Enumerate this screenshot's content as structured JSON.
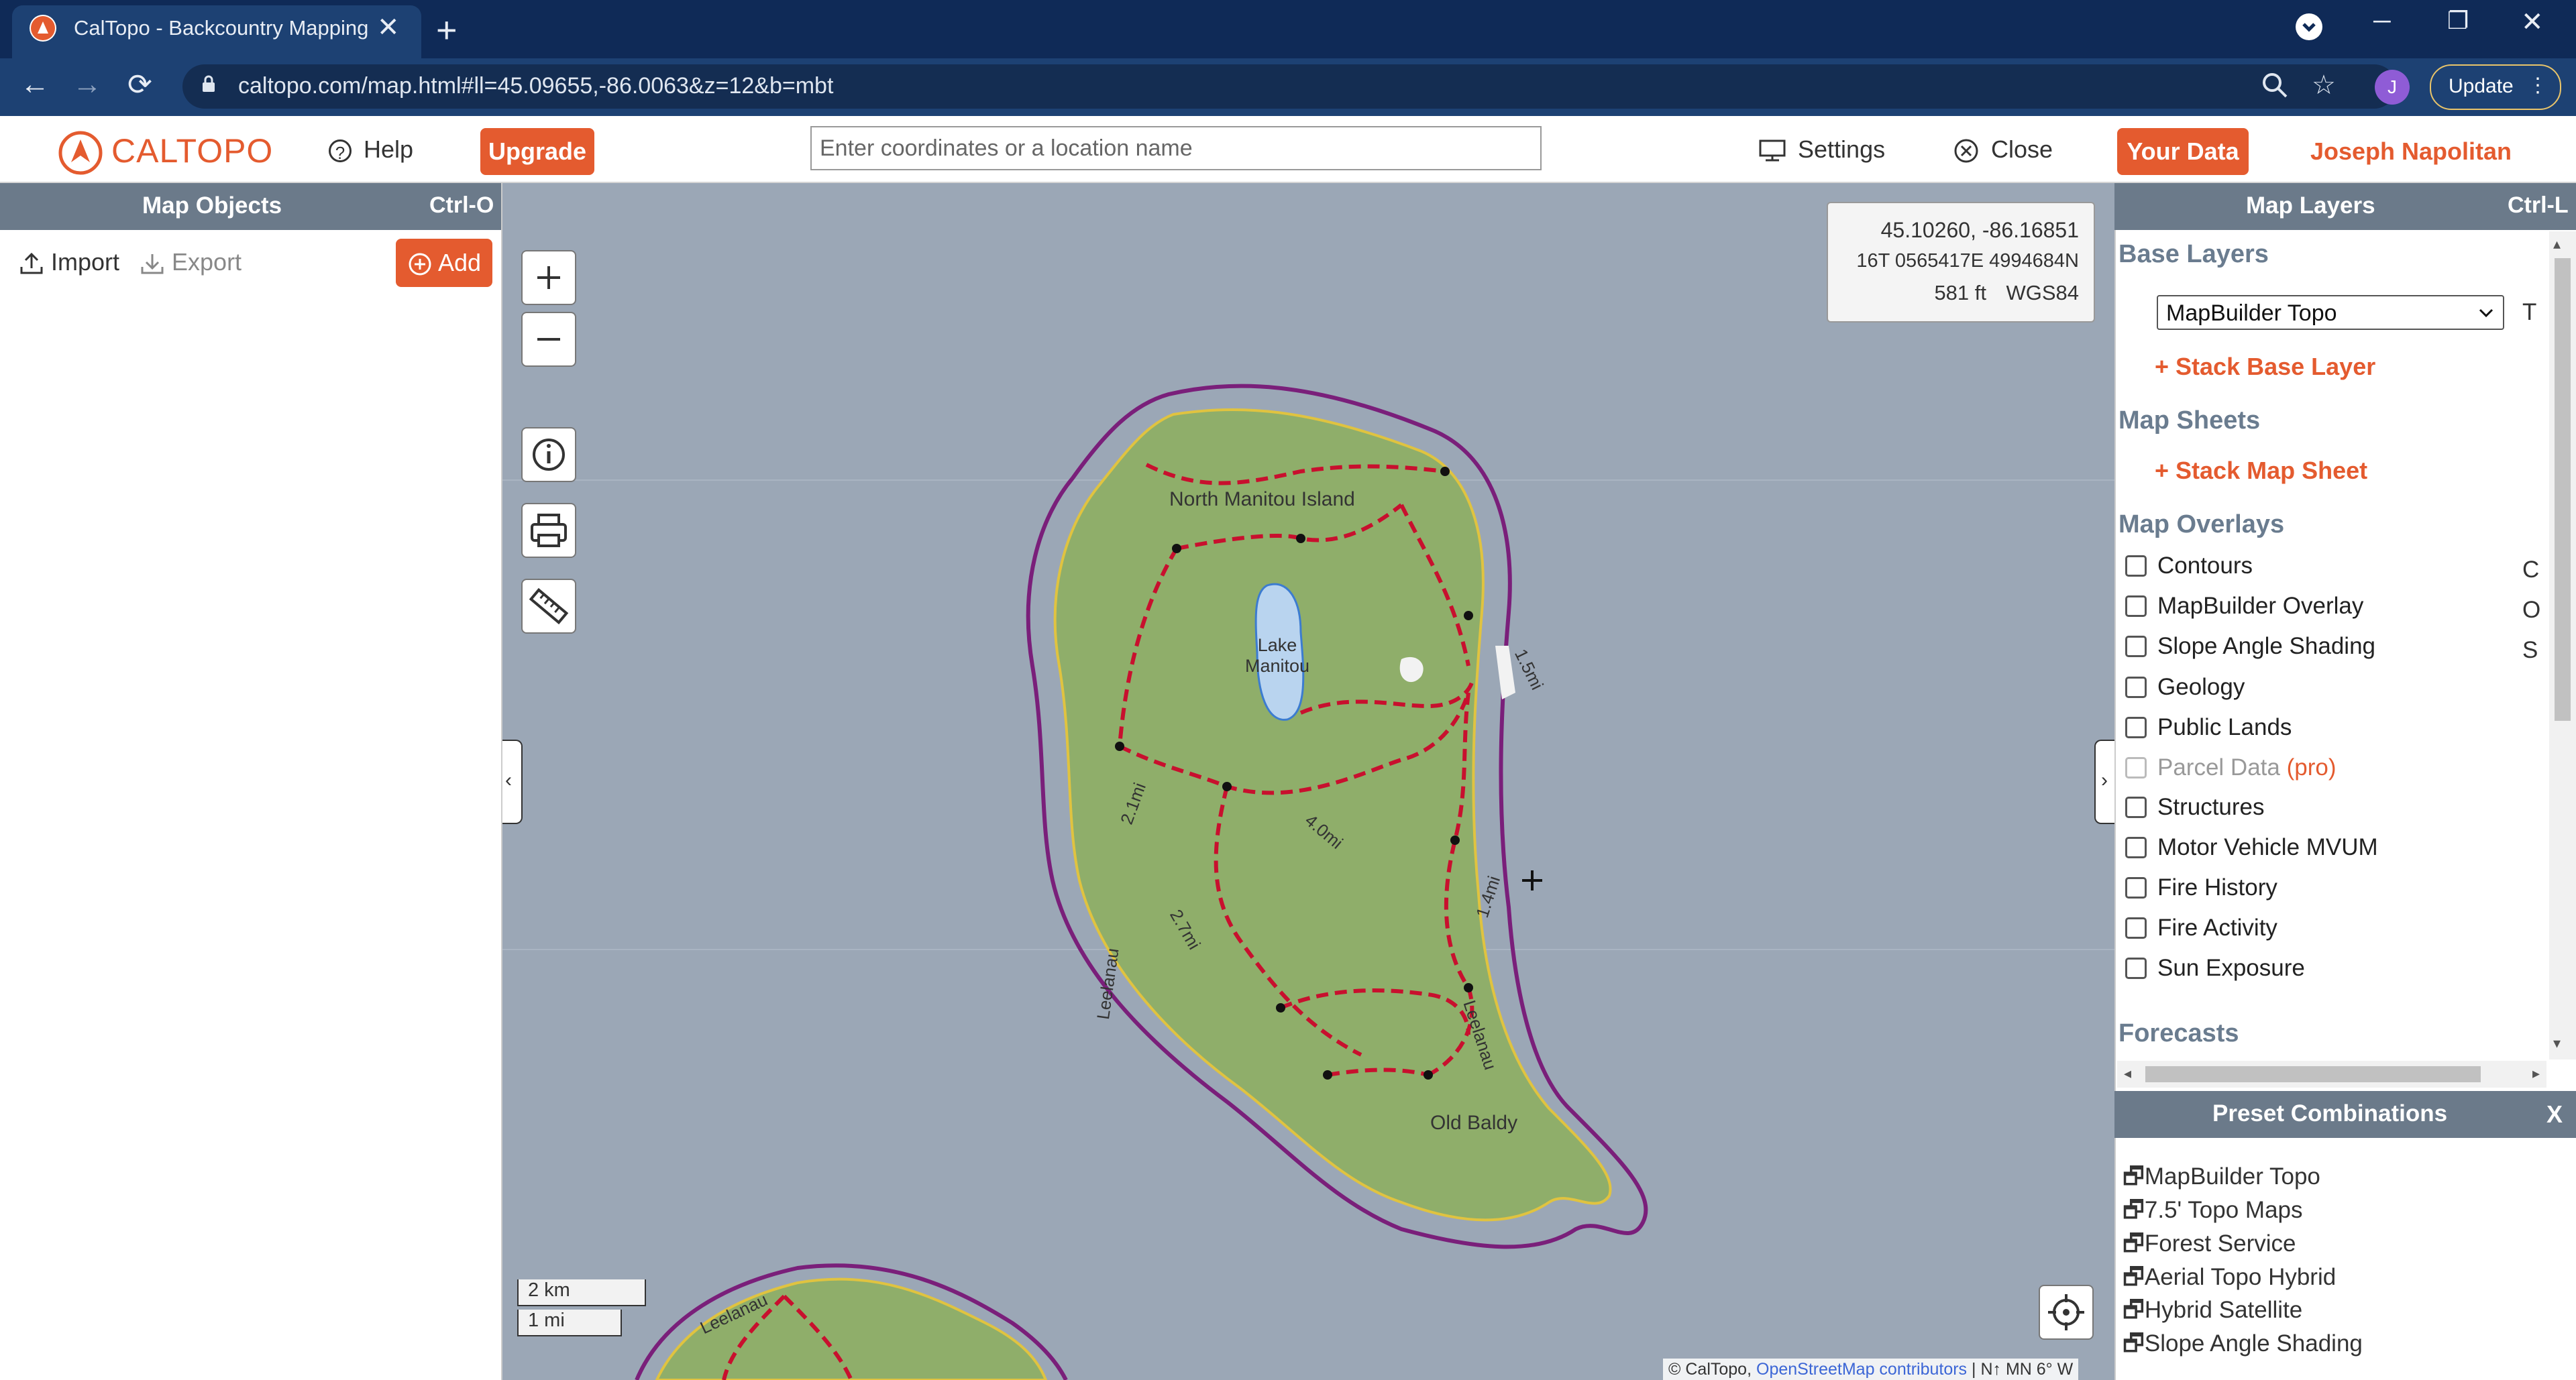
{
  "browser": {
    "tab_title": "CalTopo - Backcountry Mapping",
    "tab_close": "✕",
    "new_tab": "+",
    "url": "caltopo.com/map.html#ll=45.09655,-86.0063&z=12&b=mbt",
    "avatar_letter": "J",
    "update_label": "Update",
    "window_min": "─",
    "window_restore": "❐",
    "window_close": "✕"
  },
  "header": {
    "logo": "CALTOPO",
    "help": "Help",
    "upgrade": "Upgrade",
    "search_placeholder": "Enter coordinates or a location name",
    "settings": "Settings",
    "close": "Close",
    "your_data": "Your Data",
    "user_name": "Joseph Napolitan"
  },
  "left_panel": {
    "title": "Map Objects",
    "shortcut": "Ctrl-O",
    "import": "Import",
    "export": "Export",
    "add": "Add"
  },
  "map": {
    "coords": {
      "latlon": "45.10260, -86.16851",
      "utm": "16T 0565417E 4994684N",
      "elevation": "581 ft",
      "datum": "WGS84"
    },
    "labels": {
      "island": "North Manitou Island",
      "lake": "Lake Manitou",
      "peak": "Old Baldy",
      "leelanau": "Leelanau",
      "d15": "1.5mi",
      "d21": "2.1mi",
      "d40": "4.0mi",
      "d14": "1.4mi",
      "d27": "2.7mi"
    },
    "scale_km": "2 km",
    "scale_mi": "1 mi",
    "attribution_prefix": "© CalTopo,",
    "attribution_link": "OpenStreetMap contributors",
    "attribution_suffix": "| N↑ MN 6° W"
  },
  "right_panel": {
    "title": "Map Layers",
    "shortcut": "Ctrl-L",
    "base_layers": "Base Layers",
    "base_select": "MapBuilder Topo",
    "base_hotkey": "T",
    "stack_base": "+ Stack Base Layer",
    "map_sheets": "Map Sheets",
    "stack_sheet": "+ Stack Map Sheet",
    "map_overlays": "Map Overlays",
    "overlays": [
      {
        "label": "Contours",
        "hotkey": "C"
      },
      {
        "label": "MapBuilder Overlay",
        "hotkey": "O"
      },
      {
        "label": "Slope Angle Shading",
        "hotkey": "S"
      },
      {
        "label": "Geology",
        "hotkey": ""
      },
      {
        "label": "Public Lands",
        "hotkey": ""
      },
      {
        "label": "Parcel Data",
        "hotkey": "",
        "pro": "(pro)"
      },
      {
        "label": "Structures",
        "hotkey": ""
      },
      {
        "label": "Motor Vehicle MVUM",
        "hotkey": ""
      },
      {
        "label": "Fire History",
        "hotkey": ""
      },
      {
        "label": "Fire Activity",
        "hotkey": ""
      },
      {
        "label": "Sun Exposure",
        "hotkey": ""
      }
    ],
    "forecasts": "Forecasts",
    "preset_title": "Preset Combinations",
    "preset_close": "X",
    "presets": [
      "MapBuilder Topo",
      "7.5' Topo Maps",
      "Forest Service",
      "Aerial Topo Hybrid",
      "Hybrid Satellite",
      "Slope Angle Shading"
    ]
  },
  "colors": {
    "brand_orange": "#e45b2f",
    "panel_header": "#6b7a8a",
    "water": "#9ba7b6",
    "land": "#8fae6a",
    "boundary": "#7a1f7a",
    "trail": "#c8102e"
  }
}
